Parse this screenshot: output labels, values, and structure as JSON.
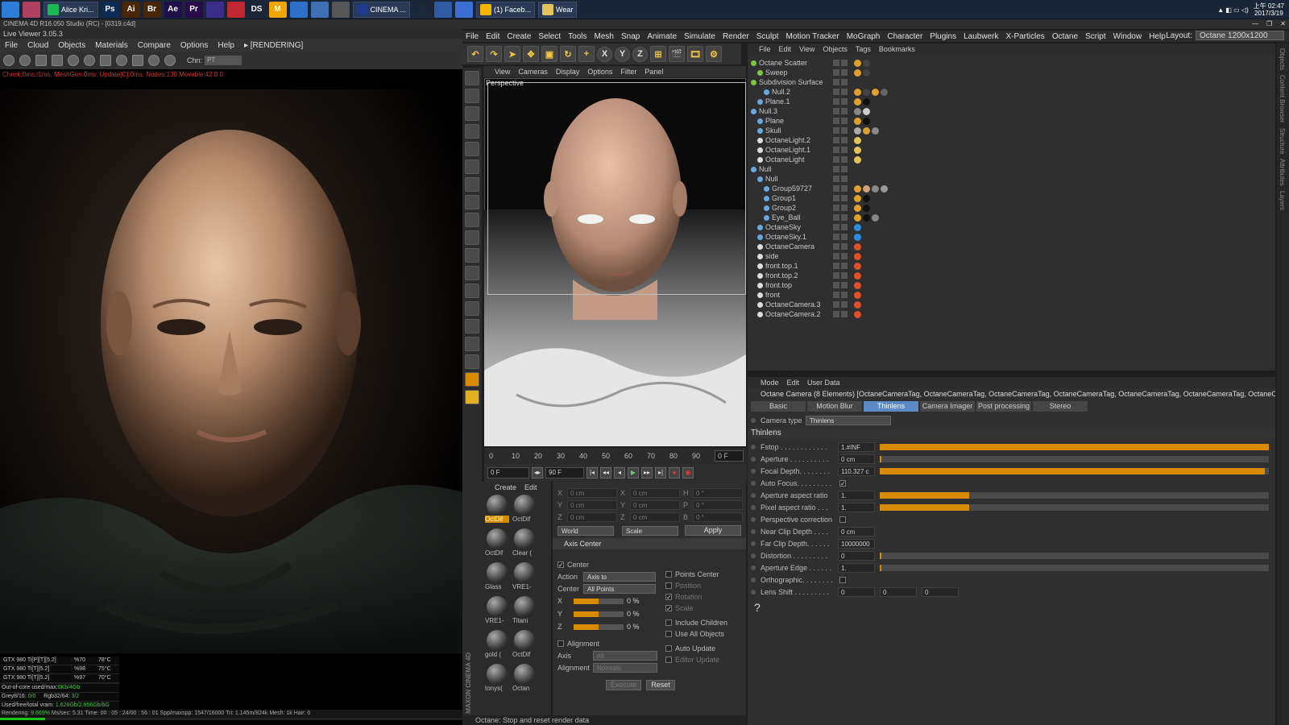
{
  "taskbar": {
    "buttons": [
      {
        "label": "Alice Kri...",
        "color": "#1db954"
      },
      {
        "label": "CINEMA ...",
        "color": "#1e3a8a"
      },
      {
        "label": "(1) Faceb...",
        "color": "#f4b400"
      },
      {
        "label": "Wear",
        "color": "#e6c35a"
      }
    ],
    "icons": [
      {
        "name": "windows-start-icon",
        "text": "",
        "color": "#2e7dd7"
      },
      {
        "name": "app-avatar-icon",
        "text": "",
        "color": "#b04060"
      },
      {
        "name": "photoshop-icon",
        "text": "Ps",
        "color": "#0c2b55"
      },
      {
        "name": "illustrator-icon",
        "text": "Ai",
        "color": "#4a2606"
      },
      {
        "name": "bridge-icon",
        "text": "Br",
        "color": "#4a2606"
      },
      {
        "name": "after-effects-icon",
        "text": "Ae",
        "color": "#1f0f4a"
      },
      {
        "name": "premiere-icon",
        "text": "Pr",
        "color": "#2a0a4a"
      },
      {
        "name": "app-icon-2",
        "text": "",
        "color": "#3b2e8a"
      },
      {
        "name": "app-icon-3",
        "text": "",
        "color": "#c0262f"
      },
      {
        "name": "daz-studio-icon",
        "text": "DS",
        "color": "#1a2638"
      },
      {
        "name": "marvelous-icon",
        "text": "M",
        "color": "#f0a500"
      },
      {
        "name": "app-icon-4",
        "text": "",
        "color": "#2c70c9"
      },
      {
        "name": "app-icon-5",
        "text": "",
        "color": "#3f6fb5"
      },
      {
        "name": "app-icon-6",
        "text": "",
        "color": "#555"
      }
    ],
    "icons_after": [
      {
        "name": "steam-icon",
        "text": "",
        "color": "#1b2838"
      },
      {
        "name": "app-icon-7",
        "text": "",
        "color": "#2d5aa0"
      },
      {
        "name": "app-icon-8",
        "text": "",
        "color": "#3b6fd4"
      }
    ],
    "clock": {
      "time": "上午 02:47",
      "date": "2017/3/19"
    }
  },
  "window_title": "CINEMA 4D R16.050 Studio (RC) - [0319.c4d]",
  "live_viewer": {
    "title": "Live Viewer 3.05.3",
    "menu": [
      "File",
      "Cloud",
      "Objects",
      "Materials",
      "Compare",
      "Options",
      "Help",
      "▸ [RENDERING]"
    ],
    "chn_label": "Chn:",
    "chn_value": "PT",
    "status": "Check:0ms./1ms. MeshGen:0ms. Update[C]:0ms. Nodes:139 Movable:42  0 0",
    "gpu_stats": [
      {
        "name": "GTX 980 Ti[P][T][5.2]",
        "pct": "%70",
        "temp": "78°C"
      },
      {
        "name": "GTX 980 Ti[T][5.2]",
        "pct": "%98",
        "temp": "75°C"
      },
      {
        "name": "GTX 980 Ti[T][5.2]",
        "pct": "%97",
        "temp": "70°C"
      }
    ],
    "out_of_core": "Out-of-core used/max:",
    "out_of_core_val": "0Kb/4Gb",
    "grey": "Grey8/16:",
    "grey_val": "0/0",
    "rgb": "Rgb32/64:",
    "rgb_val": "3/2",
    "vram": "Used/free/total vram:",
    "vram_val": "1.628Gb/2.856Gb/6G",
    "rendering": "Rendering: ",
    "rendering_pct": "9.669%",
    "bottom_rest": "Ms/sec: 5.31   Time: 00 : 05 : 24/00 : 56 : 01   Spp/maxspp: 1547/16000   Tri: 1.145m/824k   Mesh: 1k   Hair: 0",
    "progress": 0.097
  },
  "main_menu": [
    "File",
    "Edit",
    "Create",
    "Select",
    "Tools",
    "Mesh",
    "Snap",
    "Animate",
    "Simulate",
    "Render",
    "Sculpt",
    "Motion Tracker",
    "MoGraph",
    "Character",
    "Plugins",
    "Laubwerk",
    "X-Particles",
    "Octane",
    "Script",
    "Window",
    "Help"
  ],
  "layout_label": "Layout:",
  "layout_value": "Octane 1200x1200",
  "toolbar_axes": [
    "X",
    "Y",
    "Z"
  ],
  "viewport": {
    "menu": [
      "View",
      "Cameras",
      "Display",
      "Options",
      "Filter",
      "Panel"
    ],
    "label": "Perspective"
  },
  "timeline": {
    "ticks": [
      "0",
      "10",
      "20",
      "30",
      "40",
      "50",
      "60",
      "70",
      "80",
      "90"
    ],
    "frame": "0 F",
    "start": "0 F",
    "end": "90 F"
  },
  "material_manager": {
    "menu": [
      "Create",
      "Edit"
    ],
    "materials": [
      {
        "label": "OctDif",
        "selected": true
      },
      {
        "label": "OctDif",
        "selected": false
      },
      {
        "label": "OctDif",
        "selected": false
      },
      {
        "label": "Clear (",
        "selected": false
      },
      {
        "label": "Glass",
        "selected": false
      },
      {
        "label": "VRE1-",
        "selected": false
      },
      {
        "label": "VRE1-",
        "selected": false
      },
      {
        "label": "Titani",
        "selected": false
      },
      {
        "label": "gold (",
        "selected": false
      },
      {
        "label": "OctDif",
        "selected": false
      },
      {
        "label": "tonys(",
        "selected": false
      },
      {
        "label": "Octan",
        "selected": false
      }
    ]
  },
  "coords": {
    "rows": [
      {
        "a": "X",
        "av": "0 cm",
        "b": "X",
        "bv": "0 cm",
        "c": "H",
        "cv": "0 °"
      },
      {
        "a": "Y",
        "av": "0 cm",
        "b": "Y",
        "bv": "0 cm",
        "c": "P",
        "cv": "0 °"
      },
      {
        "a": "Z",
        "av": "0 cm",
        "b": "Z",
        "bv": "0 cm",
        "c": "B",
        "cv": "0 °"
      }
    ],
    "world": "World",
    "scale": "Scale",
    "apply": "Apply",
    "axis_center_title": "Axis Center",
    "center_label": "Center",
    "action_label": "Action",
    "action_value": "Axis to",
    "center2_label": "Center",
    "center2_value": "All Points",
    "sliders": [
      {
        "axis": "X",
        "value": "0 %",
        "fill": 0.5
      },
      {
        "axis": "Y",
        "value": "0 %",
        "fill": 0.5
      },
      {
        "axis": "Z",
        "value": "0 %",
        "fill": 0.5
      }
    ],
    "right_opts": [
      "Points Center",
      "Position",
      "Rotation",
      "Scale",
      "Include Children",
      "Use All Objects",
      "Auto Update",
      "Editor Update"
    ],
    "alignment": "Alignment",
    "axis_label": "Axis",
    "axis_value": "All",
    "alignment_label": "Alignment",
    "alignment_value": "Normals",
    "execute": "Execute",
    "reset": "Reset"
  },
  "status_bar": "Octane:         Stop and reset render data",
  "object_manager": {
    "menu": [
      "File",
      "Edit",
      "View",
      "Objects",
      "Tags",
      "Bookmarks"
    ],
    "objects": [
      {
        "name": "Octane Scatter",
        "indent": 0,
        "color": "#7ac943",
        "tags": [
          "#e0a030",
          "#444"
        ]
      },
      {
        "name": "Sweep",
        "indent": 1,
        "color": "#7ac943",
        "tags": [
          "#e0a030",
          "#444"
        ]
      },
      {
        "name": "Subdivision Surface",
        "indent": 0,
        "color": "#7ac943",
        "tags": []
      },
      {
        "name": "Null.2",
        "indent": 2,
        "color": "#6aa9e0",
        "tags": [
          "#e0a030",
          "#444",
          "#e0a030",
          "#666"
        ]
      },
      {
        "name": "Plane.1",
        "indent": 1,
        "color": "#6aa9e0",
        "tags": [
          "#e0a030",
          "#111"
        ]
      },
      {
        "name": "Null.3",
        "indent": 0,
        "color": "#6aa9e0",
        "tags": [
          "#888",
          "#ccc"
        ]
      },
      {
        "name": "Plane",
        "indent": 1,
        "color": "#6aa9e0",
        "tags": [
          "#e0a030",
          "#111"
        ]
      },
      {
        "name": "Skull",
        "indent": 1,
        "color": "#6aa9e0",
        "tags": [
          "#aaa",
          "#e0a030",
          "#888"
        ]
      },
      {
        "name": "OctaneLight.2",
        "indent": 1,
        "color": "#ddd",
        "tags": [
          "#e6c35a"
        ]
      },
      {
        "name": "OctaneLight.1",
        "indent": 1,
        "color": "#ddd",
        "tags": [
          "#e6c35a"
        ]
      },
      {
        "name": "OctaneLight",
        "indent": 1,
        "color": "#ddd",
        "tags": [
          "#e6c35a"
        ]
      },
      {
        "name": "Null",
        "indent": 0,
        "color": "#6aa9e0",
        "tags": []
      },
      {
        "name": "Null",
        "indent": 1,
        "color": "#6aa9e0",
        "tags": []
      },
      {
        "name": "Group59727",
        "indent": 2,
        "color": "#6aa9e0",
        "tags": [
          "#e0a030",
          "#d4a27a",
          "#888",
          "#999"
        ]
      },
      {
        "name": "Group1",
        "indent": 2,
        "color": "#6aa9e0",
        "tags": [
          "#e0a030",
          "#111"
        ]
      },
      {
        "name": "Group2",
        "indent": 2,
        "color": "#6aa9e0",
        "tags": [
          "#e0a030",
          "#111"
        ]
      },
      {
        "name": "Eye_Ball",
        "indent": 2,
        "color": "#6aa9e0",
        "tags": [
          "#e0a030",
          "#111",
          "#888"
        ]
      },
      {
        "name": "OctaneSky",
        "indent": 1,
        "color": "#6aa9e0",
        "tags": [
          "#2a8de0"
        ]
      },
      {
        "name": "OctaneSky.1",
        "indent": 1,
        "color": "#6aa9e0",
        "tags": [
          "#2a8de0"
        ]
      },
      {
        "name": "OctaneCamera",
        "indent": 1,
        "color": "#ddd",
        "tags": [
          "#e0502a"
        ]
      },
      {
        "name": "side",
        "indent": 1,
        "color": "#ddd",
        "tags": [
          "#e0502a"
        ]
      },
      {
        "name": "front.top.1",
        "indent": 1,
        "color": "#ddd",
        "tags": [
          "#e0502a"
        ]
      },
      {
        "name": "front.top.2",
        "indent": 1,
        "color": "#ddd",
        "tags": [
          "#e0502a"
        ]
      },
      {
        "name": "front.top",
        "indent": 1,
        "color": "#ddd",
        "tags": [
          "#e0502a"
        ]
      },
      {
        "name": "front",
        "indent": 1,
        "color": "#ddd",
        "tags": [
          "#e0502a"
        ]
      },
      {
        "name": "OctaneCamera.3",
        "indent": 1,
        "color": "#ddd",
        "tags": [
          "#e0502a"
        ]
      },
      {
        "name": "OctaneCamera.2",
        "indent": 1,
        "color": "#ddd",
        "tags": [
          "#e0502a"
        ]
      }
    ]
  },
  "attributes": {
    "menu": [
      "Mode",
      "Edit",
      "User Data"
    ],
    "title": "Octane Camera (8 Elements) [OctaneCameraTag, OctaneCameraTag, OctaneCameraTag, OctaneCameraTag, OctaneCameraTag, OctaneCameraTag, OctaneCameraTag, Octan",
    "tabs": [
      {
        "label": "Basic",
        "active": false
      },
      {
        "label": "Motion Blur",
        "active": false
      },
      {
        "label": "Thinlens",
        "active": true
      },
      {
        "label": "Camera Imager",
        "active": false
      },
      {
        "label": "Post processing",
        "active": false
      },
      {
        "label": "Stereo",
        "active": false
      }
    ],
    "camera_type_label": "Camera type",
    "camera_type_value": "Thinlens",
    "section": "Thinlens",
    "params": [
      {
        "label": "Fstop . . . . . . . . . . . .",
        "value": "1.#INF",
        "fill": 1.0
      },
      {
        "label": "Aperture . . . . . . . . . .",
        "value": "0 cm",
        "fill": 0.0
      },
      {
        "label": "Focal Depth. . . . . . . .",
        "value": "110.327 c",
        "fill": 0.99
      },
      {
        "label": "Auto Focus. . . . . . . . .",
        "value": "✓",
        "fill": null
      },
      {
        "label": "Aperture aspect ratio",
        "value": "1.",
        "fill": 0.23
      },
      {
        "label": "Pixel aspect ratio . . .",
        "value": "1.",
        "fill": 0.23
      },
      {
        "label": "Perspective correction",
        "value": "□",
        "fill": null
      },
      {
        "label": "Near Clip Depth . . . .",
        "value": "0 cm",
        "fill": null
      },
      {
        "label": "Far Clip Depth. . . . . .",
        "value": "10000000",
        "fill": null
      },
      {
        "label": "Distortion . . . . . . . . .",
        "value": "0",
        "fill": 0.0
      },
      {
        "label": "Aperture Edge . . . . . .",
        "value": "1.",
        "fill": 0.0
      },
      {
        "label": "Orthographic. . . . . . . .",
        "value": "□",
        "fill": null
      },
      {
        "label": "Lens Shift . . . . . . . . .",
        "value": "0",
        "fill": null
      }
    ],
    "lens_shift_extra": [
      "0",
      "0"
    ],
    "help": "?"
  },
  "side_tabs": [
    "Objects",
    "Content Browser",
    "Structure",
    "Attributes",
    "Layers"
  ]
}
